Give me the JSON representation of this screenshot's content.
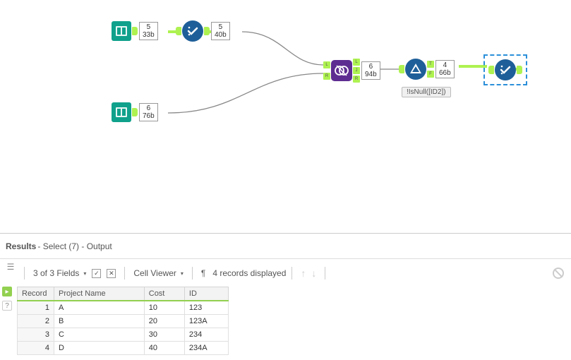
{
  "nodes": {
    "input1": {
      "count": "5",
      "bytes": "33b"
    },
    "select1": {
      "count": "5",
      "bytes": "40b"
    },
    "input2": {
      "count": "6",
      "bytes": "76b"
    },
    "join": {
      "count": "6",
      "bytes": "94b"
    },
    "filter": {
      "count": "4",
      "bytes": "66b",
      "caption": "!IsNull([ID2])"
    }
  },
  "results": {
    "title_main": "Results",
    "title_rest": " - Select (7) - Output",
    "fields_label": "3 of 3 Fields",
    "cell_viewer": "Cell Viewer",
    "records_label": "4 records displayed",
    "columns": [
      "Record",
      "Project Name",
      "Cost",
      "ID"
    ],
    "rows": [
      [
        "1",
        "A",
        "10",
        "123"
      ],
      [
        "2",
        "B",
        "20",
        "123A"
      ],
      [
        "3",
        "C",
        "30",
        "234"
      ],
      [
        "4",
        "D",
        "40",
        "234A"
      ]
    ]
  }
}
